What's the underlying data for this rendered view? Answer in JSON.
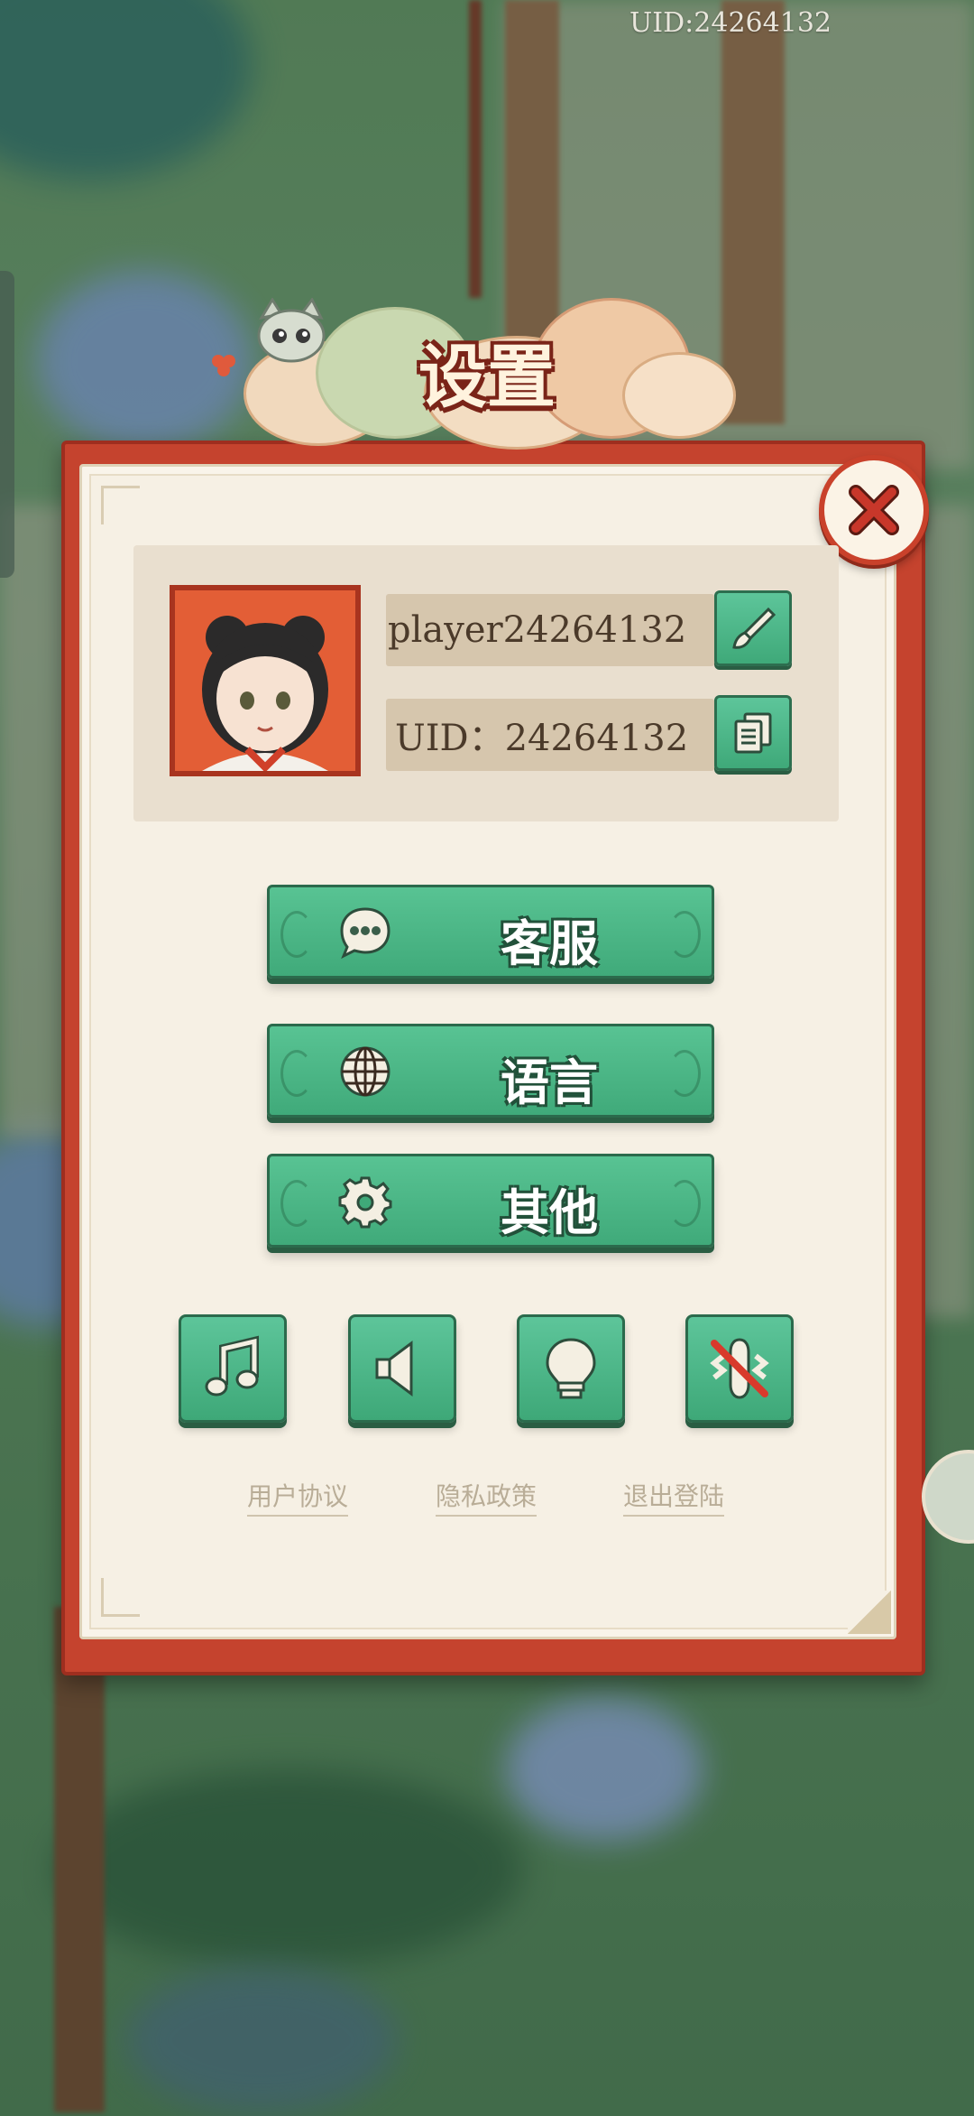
{
  "top_uid": "UID:24264132",
  "dialog": {
    "title": "设置",
    "player_name": "player24264132",
    "uid_label": "UID：24264132"
  },
  "menu": {
    "service": "客服",
    "language": "语言",
    "other": "其他"
  },
  "links": {
    "agreement": "用户协议",
    "privacy": "隐私政策",
    "logout": "退出登陆"
  },
  "toggles": {
    "music": "music-note-icon",
    "sound": "speaker-icon",
    "light": "light-bulb-icon",
    "vibration": "vibration-off-icon"
  },
  "colors": {
    "accent_green": "#48b283",
    "frame_red": "#c5432e",
    "paper": "#f6f0e4"
  }
}
